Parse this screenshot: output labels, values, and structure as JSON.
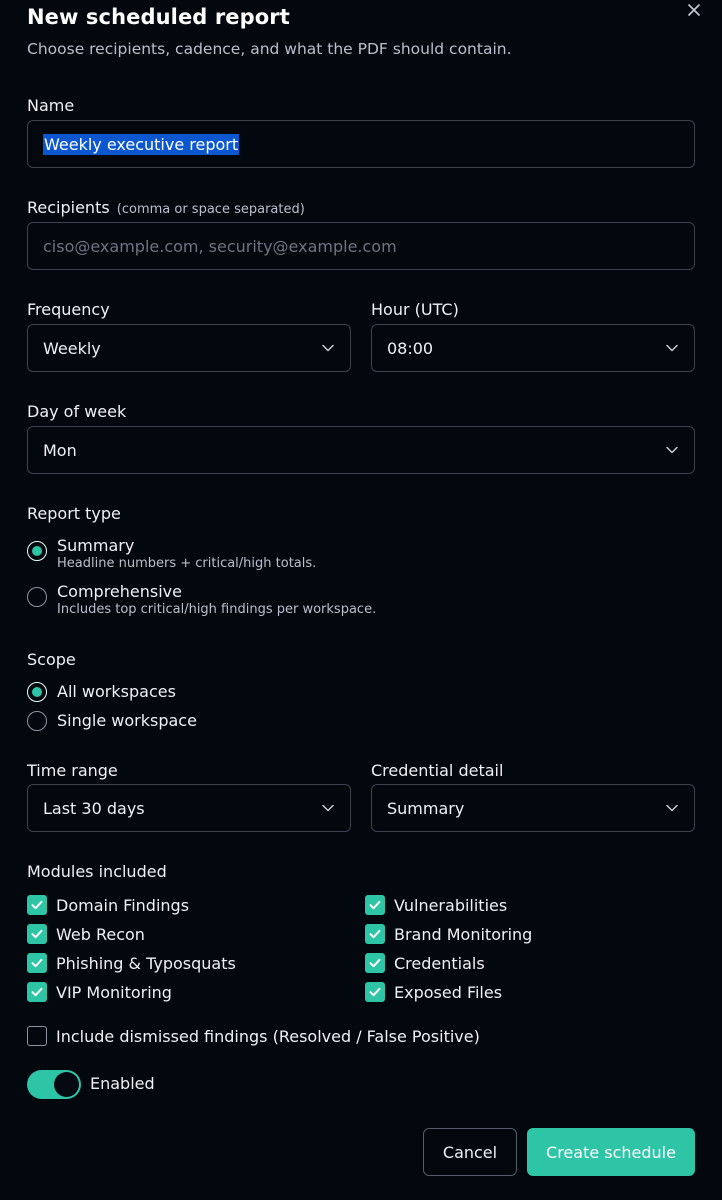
{
  "dialog": {
    "title": "New scheduled report",
    "subtitle": "Choose recipients, cadence, and what the PDF should contain.",
    "close_icon": "close-icon"
  },
  "name": {
    "label": "Name",
    "value": "Weekly executive report"
  },
  "recipients": {
    "label": "Recipients",
    "hint": "(comma or space separated)",
    "placeholder": "ciso@example.com, security@example.com"
  },
  "frequency": {
    "label": "Frequency",
    "value": "Weekly"
  },
  "hour": {
    "label": "Hour (UTC)",
    "value": "08:00"
  },
  "day_of_week": {
    "label": "Day of week",
    "value": "Mon"
  },
  "report_type": {
    "label": "Report type",
    "options": [
      {
        "label": "Summary",
        "description": "Headline numbers + critical/high totals.",
        "selected": true
      },
      {
        "label": "Comprehensive",
        "description": "Includes top critical/high findings per workspace.",
        "selected": false
      }
    ]
  },
  "scope": {
    "label": "Scope",
    "options": [
      {
        "label": "All workspaces",
        "selected": true
      },
      {
        "label": "Single workspace",
        "selected": false
      }
    ]
  },
  "time_range": {
    "label": "Time range",
    "value": "Last 30 days"
  },
  "credential_detail": {
    "label": "Credential detail",
    "value": "Summary"
  },
  "modules": {
    "label": "Modules included",
    "items": [
      {
        "label": "Domain Findings",
        "checked": true
      },
      {
        "label": "Vulnerabilities",
        "checked": true
      },
      {
        "label": "Web Recon",
        "checked": true
      },
      {
        "label": "Brand Monitoring",
        "checked": true
      },
      {
        "label": "Phishing & Typosquats",
        "checked": true
      },
      {
        "label": "Credentials",
        "checked": true
      },
      {
        "label": "VIP Monitoring",
        "checked": true
      },
      {
        "label": "Exposed Files",
        "checked": true
      }
    ]
  },
  "include_dismissed": {
    "label": "Include dismissed findings (Resolved / False Positive)",
    "checked": false
  },
  "enabled_toggle": {
    "label": "Enabled",
    "on": true
  },
  "actions": {
    "cancel_label": "Cancel",
    "create_label": "Create schedule"
  },
  "colors": {
    "accent": "#2ec4a6",
    "background": "#03070e",
    "border": "#3c434e",
    "selection": "#0b57d0"
  }
}
